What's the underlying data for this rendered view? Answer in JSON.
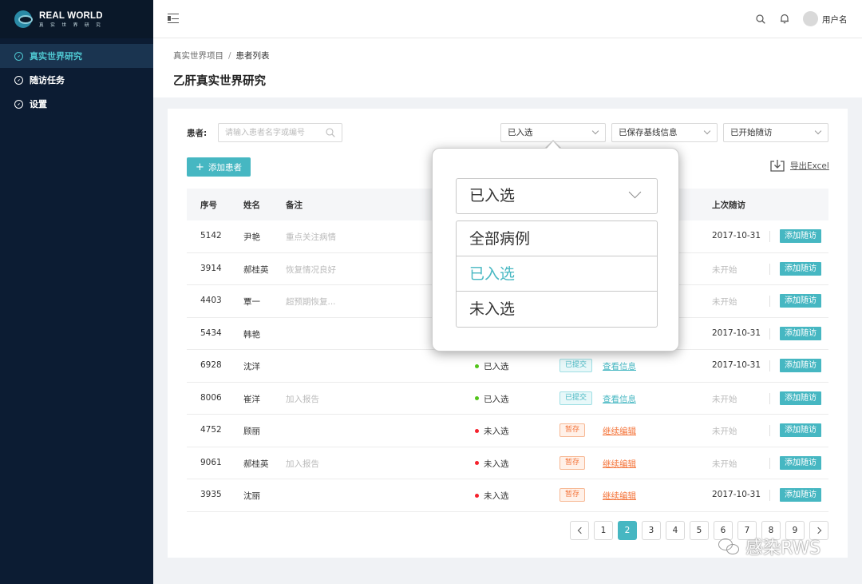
{
  "app": {
    "logo_title": "REAL WORLD",
    "logo_subtitle": "真 实 世 界 研 究"
  },
  "sidebar": {
    "items": [
      {
        "label": "真实世界研究",
        "icon": "dashboard-icon",
        "active": true
      },
      {
        "label": "随访任务",
        "icon": "dashboard-icon",
        "active": false
      },
      {
        "label": "设置",
        "icon": "dashboard-icon",
        "active": false
      }
    ]
  },
  "header": {
    "username": "用户名"
  },
  "breadcrumb": {
    "parent": "真实世界项目",
    "separator": "/",
    "current": "患者列表"
  },
  "page": {
    "title": "乙肝真实世界研究"
  },
  "filters": {
    "patient_label": "患者:",
    "search_placeholder": "请输入患者名字或编号",
    "enroll_select": "已入选",
    "baseline_select": "已保存基线信息",
    "followup_select": "已开始随访"
  },
  "toolbar": {
    "add_label": "添加患者",
    "export_label": "导出Excel"
  },
  "table": {
    "columns": {
      "id": "序号",
      "name": "姓名",
      "note": "备注",
      "last_followup": "上次随访"
    },
    "rows": [
      {
        "id": "5142",
        "name": "尹艳",
        "note": "重点关注病情",
        "status": "",
        "form": "",
        "action": "",
        "last": "2017-10-31",
        "btn": "添加随访"
      },
      {
        "id": "3914",
        "name": "郝桂英",
        "note": "恢复情况良好",
        "status": "",
        "form": "",
        "action": "",
        "last": "未开始",
        "btn": "添加随访"
      },
      {
        "id": "4403",
        "name": "覃一",
        "note": "超预期恢复...",
        "status": "",
        "form": "",
        "action": "",
        "last": "未开始",
        "btn": "添加随访"
      },
      {
        "id": "5434",
        "name": "韩艳",
        "note": "",
        "status": "",
        "form": "",
        "action": "",
        "last": "2017-10-31",
        "btn": "添加随访"
      },
      {
        "id": "6928",
        "name": "沈洋",
        "note": "",
        "status": "已入选",
        "form": "已提交",
        "action": "查看信息",
        "last": "2017-10-31",
        "btn": "添加随访"
      },
      {
        "id": "8006",
        "name": "崔洋",
        "note": "加入报告",
        "status": "已入选",
        "form": "已提交",
        "action": "查看信息",
        "last": "未开始",
        "btn": "添加随访"
      },
      {
        "id": "4752",
        "name": "顾丽",
        "note": "",
        "status": "未入选",
        "form": "暂存",
        "action": "继续编辑",
        "last": "未开始",
        "btn": "添加随访"
      },
      {
        "id": "9061",
        "name": "郝桂英",
        "note": "加入报告",
        "status": "未入选",
        "form": "暂存",
        "action": "继续编辑",
        "last": "未开始",
        "btn": "添加随访"
      },
      {
        "id": "3935",
        "name": "沈丽",
        "note": "",
        "status": "未入选",
        "form": "暂存",
        "action": "继续编辑",
        "last": "2017-10-31",
        "btn": "添加随访"
      }
    ]
  },
  "pagination": {
    "pages": [
      "1",
      "2",
      "3",
      "4",
      "5",
      "6",
      "7",
      "8",
      "9"
    ],
    "current": "2"
  },
  "dropdown": {
    "value": "已入选",
    "options": [
      "全部病例",
      "已入选",
      "未入选"
    ],
    "selected": "已入选"
  },
  "watermark": {
    "text": "感染RWS"
  },
  "colors": {
    "accent": "#46b7c2",
    "warning": "#f4743a",
    "enrolled_dot": "#52c41a",
    "not_enrolled_dot": "#f5222d",
    "sidebar": "#0c1c33"
  }
}
